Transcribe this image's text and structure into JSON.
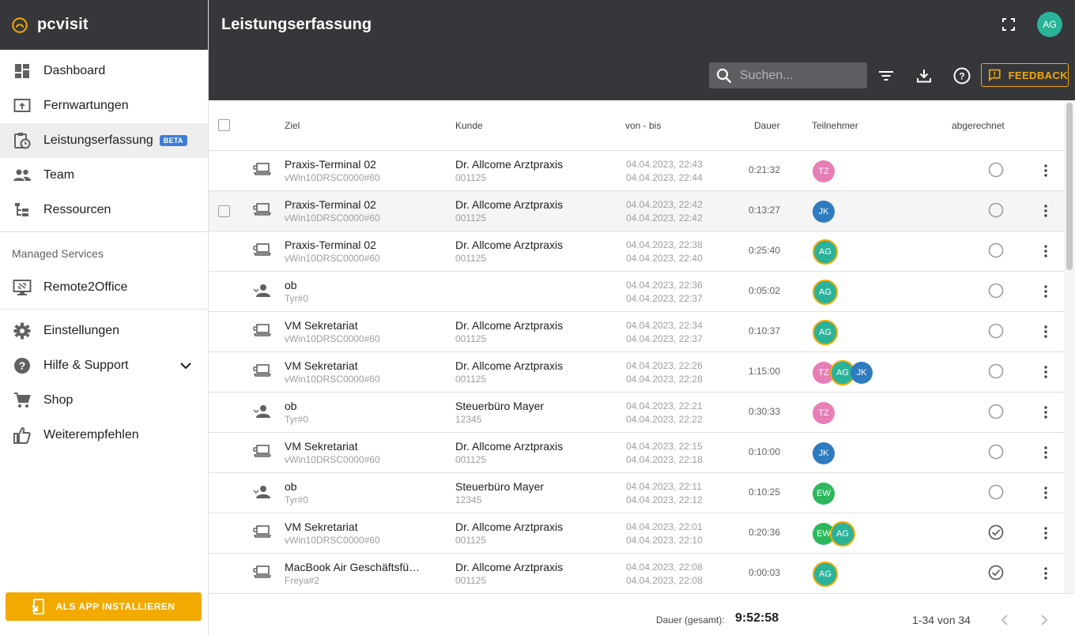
{
  "brand": {
    "name": "pcvisit"
  },
  "sidebar": {
    "items": [
      {
        "label": "Dashboard",
        "icon": "dashboard-icon"
      },
      {
        "label": "Fernwartungen",
        "icon": "remote-icon"
      },
      {
        "label": "Leistungserfassung",
        "icon": "clipboard-clock-icon",
        "badge": "BETA"
      },
      {
        "label": "Team",
        "icon": "people-icon"
      },
      {
        "label": "Ressourcen",
        "icon": "tree-icon"
      }
    ],
    "managed_services_title": "Managed Services",
    "managed_items": [
      {
        "label": "Remote2Office",
        "icon": "remote-desktop-icon"
      }
    ],
    "bottom_items": [
      {
        "label": "Einstellungen",
        "icon": "gear-icon"
      },
      {
        "label": "Hilfe & Support",
        "icon": "help-icon"
      },
      {
        "label": "Shop",
        "icon": "cart-icon"
      },
      {
        "label": "Weiterempfehlen",
        "icon": "thumb-up-icon"
      }
    ],
    "install_button": "ALS APP INSTALLIEREN"
  },
  "header": {
    "title": "Leistungserfassung",
    "avatar": "AG",
    "search_placeholder": "Suchen...",
    "feedback_label": "FEEDBACK"
  },
  "table": {
    "columns": {
      "ziel": "Ziel",
      "kunde": "Kunde",
      "zeit": "von - bis",
      "dauer": "Dauer",
      "teilnehmer": "Teilnehmer",
      "abgerechnet": "abgerechnet"
    },
    "rows": [
      {
        "type": "computer",
        "ziel": "Praxis-Terminal 02",
        "ziel_sub": "vWin10DRSC0000#60",
        "kunde": "Dr. Allcome Arztpraxis",
        "kunde_sub": "001125",
        "von": "04.04.2023, 22:43",
        "bis": "04.04.2023, 22:44",
        "dauer": "0:21:32",
        "teilnehmer": [
          "TZ"
        ],
        "abgerechnet": false
      },
      {
        "type": "computer",
        "ziel": "Praxis-Terminal 02",
        "ziel_sub": "vWin10DRSC0000#60",
        "kunde": "Dr. Allcome Arztpraxis",
        "kunde_sub": "001125",
        "von": "04.04.2023, 22:42",
        "bis": "04.04.2023, 22:42",
        "dauer": "0:13:27",
        "teilnehmer": [
          "JK"
        ],
        "abgerechnet": false
      },
      {
        "type": "computer",
        "ziel": "Praxis-Terminal 02",
        "ziel_sub": "vWin10DRSC0000#60",
        "kunde": "Dr. Allcome Arztpraxis",
        "kunde_sub": "001125",
        "von": "04.04.2023, 22:38",
        "bis": "04.04.2023, 22:40",
        "dauer": "0:25:40",
        "teilnehmer": [
          "AG"
        ],
        "abgerechnet": false
      },
      {
        "type": "person",
        "ziel": "ob",
        "ziel_sub": "Tyr#0",
        "kunde": "",
        "kunde_sub": "",
        "von": "04.04.2023, 22:36",
        "bis": "04.04.2023, 22:37",
        "dauer": "0:05:02",
        "teilnehmer": [
          "AG"
        ],
        "abgerechnet": false
      },
      {
        "type": "computer",
        "ziel": "VM Sekretariat",
        "ziel_sub": "vWin10DRSC0000#60",
        "kunde": "Dr. Allcome Arztpraxis",
        "kunde_sub": "001125",
        "von": "04.04.2023, 22:34",
        "bis": "04.04.2023, 22:37",
        "dauer": "0:10:37",
        "teilnehmer": [
          "AG"
        ],
        "abgerechnet": false
      },
      {
        "type": "computer",
        "ziel": "VM Sekretariat",
        "ziel_sub": "vWin10DRSC0000#60",
        "kunde": "Dr. Allcome Arztpraxis",
        "kunde_sub": "001125",
        "von": "04.04.2023, 22:26",
        "bis": "04.04.2023, 22:28",
        "dauer": "1:15:00",
        "teilnehmer": [
          "TZ",
          "AG",
          "JK"
        ],
        "abgerechnet": false
      },
      {
        "type": "person",
        "ziel": "ob",
        "ziel_sub": "Tyr#0",
        "kunde": "Steuerbüro Mayer",
        "kunde_sub": "12345",
        "von": "04.04.2023, 22:21",
        "bis": "04.04.2023, 22:22",
        "dauer": "0:30:33",
        "teilnehmer": [
          "TZ"
        ],
        "abgerechnet": false
      },
      {
        "type": "computer",
        "ziel": "VM Sekretariat",
        "ziel_sub": "vWin10DRSC0000#60",
        "kunde": "Dr. Allcome Arztpraxis",
        "kunde_sub": "001125",
        "von": "04.04.2023, 22:15",
        "bis": "04.04.2023, 22:18",
        "dauer": "0:10:00",
        "teilnehmer": [
          "JK"
        ],
        "abgerechnet": false
      },
      {
        "type": "person",
        "ziel": "ob",
        "ziel_sub": "Tyr#0",
        "kunde": "Steuerbüro Mayer",
        "kunde_sub": "12345",
        "von": "04.04.2023, 22:11",
        "bis": "04.04.2023, 22:12",
        "dauer": "0:10:25",
        "teilnehmer": [
          "EW"
        ],
        "abgerechnet": false
      },
      {
        "type": "computer",
        "ziel": "VM Sekretariat",
        "ziel_sub": "vWin10DRSC0000#60",
        "kunde": "Dr. Allcome Arztpraxis",
        "kunde_sub": "001125",
        "von": "04.04.2023, 22:01",
        "bis": "04.04.2023, 22:10",
        "dauer": "0:20:36",
        "teilnehmer": [
          "EW",
          "AG"
        ],
        "abgerechnet": true
      },
      {
        "type": "computer",
        "ziel": "MacBook Air Geschäftsfü…",
        "ziel_sub": "Freya#2",
        "kunde": "Dr. Allcome Arztpraxis",
        "kunde_sub": "001125",
        "von": "04.04.2023, 22:08",
        "bis": "04.04.2023, 22:08",
        "dauer": "0:00:03",
        "teilnehmer": [
          "AG"
        ],
        "abgerechnet": true
      }
    ]
  },
  "avatar_colors": {
    "TZ": "#e77fb6",
    "JK": "#2f7bbf",
    "AG": "#2ab399",
    "EW": "#2cb85c"
  },
  "footer": {
    "sum_label": "Dauer (gesamt):",
    "sum_value": "9:52:58",
    "pager_info": "1-34 von 34"
  },
  "colors": {
    "header_bg": "#36373b",
    "accent": "#f2a900",
    "beta_badge": "#3d7cd6"
  }
}
